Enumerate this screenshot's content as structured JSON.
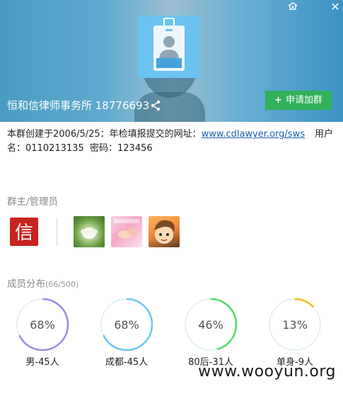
{
  "window": {
    "skin_icon": "skin-icon",
    "close_icon": "close-icon",
    "close_glyph": "✕"
  },
  "header": {
    "group_name": "恒和信律师事务所 18776693",
    "apply_label": "申请加群",
    "apply_plus": "+",
    "share_icon": "share-icon",
    "avatar_icon": "id-badge-icon"
  },
  "description": {
    "line1_prefix": "本群创建于2006/5/25：年检填报提交的网址：",
    "url": "www.cdlawyer.org/sws",
    "line1_suffix": "用户",
    "line2_prefix": "名：",
    "username": "0110213135",
    "password_label": "密码：",
    "password": "123456"
  },
  "admins": {
    "title": "群主/管理员",
    "owner_glyph": "信",
    "items": [
      "owner",
      "admin-lotus",
      "admin-hands",
      "admin-cartoon"
    ]
  },
  "distribution": {
    "title": "成员分布",
    "count": "(66/500)",
    "stats": [
      {
        "pct": "68%",
        "label": "男-45人",
        "value": 68,
        "color": "#9b8be8"
      },
      {
        "pct": "68%",
        "label": "成都-45人",
        "value": 68,
        "color": "#6cc6f2"
      },
      {
        "pct": "46%",
        "label": "80后-31人",
        "value": 46,
        "color": "#4ddc68"
      },
      {
        "pct": "13%",
        "label": "单身-9人",
        "value": 13,
        "color": "#f2bb10"
      }
    ]
  },
  "watermark": "www.wooyun.org"
}
